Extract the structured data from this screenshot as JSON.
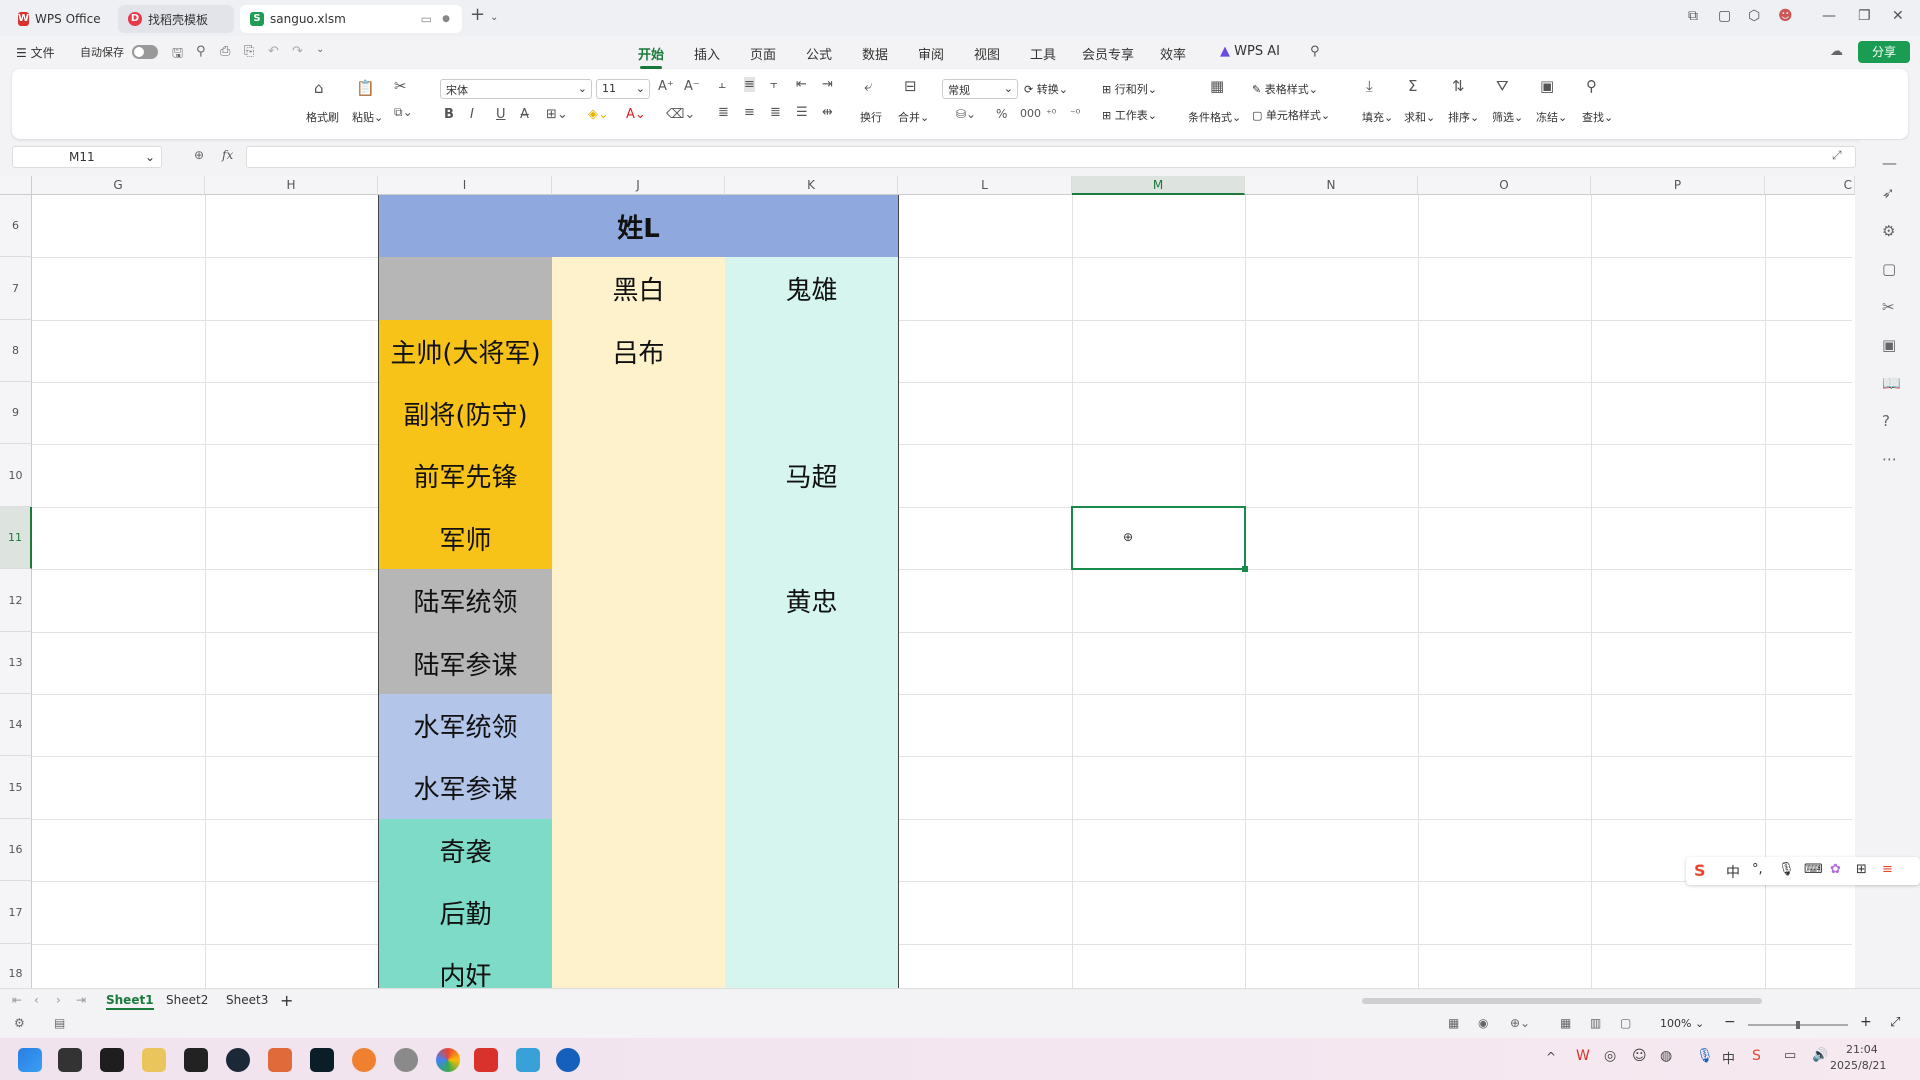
{
  "tabs": [
    {
      "label": "WPS Office",
      "icon": "wps-logo-icon",
      "color": "#d9312b"
    },
    {
      "label": "找稻壳模板",
      "icon": "docer-icon",
      "color": "#e8384a"
    },
    {
      "label": "sanguo.xlsm",
      "icon": "spreadsheet-icon",
      "color": "#1f9d55"
    }
  ],
  "menu": {
    "file": "文件",
    "autosave": "自动保存",
    "tabs": [
      "开始",
      "插入",
      "页面",
      "公式",
      "数据",
      "审阅",
      "视图",
      "工具",
      "会员专享",
      "效率",
      "WPS AI"
    ],
    "active": "开始",
    "share": "分享"
  },
  "ribbon": {
    "format_painter": "格式刷",
    "paste": "粘贴",
    "font_name": "宋体",
    "font_size": "11",
    "wrap": "换行",
    "merge": "合并",
    "number_format": "常规",
    "convert": "转换",
    "rows_cols": "行和列",
    "worksheet": "工作表",
    "cond_format": "条件格式",
    "table_style": "表格样式",
    "cell_style": "单元格样式",
    "fill": "填充",
    "sum": "求和",
    "sort": "排序",
    "filter": "筛选",
    "freeze": "冻结",
    "find": "查找",
    "bold": "B",
    "italic": "I",
    "underline": "U"
  },
  "formula": {
    "namebox": "M11",
    "fx": "fx",
    "value": ""
  },
  "columns": [
    "G",
    "H",
    "I",
    "J",
    "K",
    "L",
    "M",
    "N",
    "O",
    "P",
    "C"
  ],
  "rows": [
    "6",
    "7",
    "8",
    "9",
    "10",
    "11",
    "12",
    "13",
    "14",
    "15",
    "16",
    "17",
    "18"
  ],
  "table": {
    "title": "姓L",
    "header": [
      "",
      "黑白",
      "鬼雄"
    ],
    "roles": [
      "主帅(大将军)",
      "副将(防守)",
      "前军先锋",
      "军师",
      "陆军统领",
      "陆军参谋",
      "水军统领",
      "水军参谋",
      "奇袭",
      "后勤",
      "内奸"
    ],
    "col_j": [
      "吕布",
      "",
      "",
      "",
      "",
      "",
      "",
      "",
      "",
      "",
      ""
    ],
    "col_k": [
      "",
      "",
      "马超",
      "",
      "黄忠",
      "",
      "",
      "",
      "",
      "",
      ""
    ],
    "role_colors": [
      "#f8c318",
      "#f8c318",
      "#f8c318",
      "#f8c318",
      "#b6b6b6",
      "#b6b6b6",
      "#b4c5ea",
      "#b4c5ea",
      "#7edbc8",
      "#7edbc8",
      "#7edbc8"
    ],
    "title_color": "#8fa8de",
    "j_color": "#fdf2cc",
    "k_color": "#d5f5ee"
  },
  "sheets": [
    "Sheet1",
    "Sheet2",
    "Sheet3"
  ],
  "active_sheet": "Sheet1",
  "status": {
    "zoom": "100%"
  },
  "ime": {
    "mode": "中"
  },
  "clock": {
    "time": "21:04",
    "date": "2025/8/21"
  }
}
